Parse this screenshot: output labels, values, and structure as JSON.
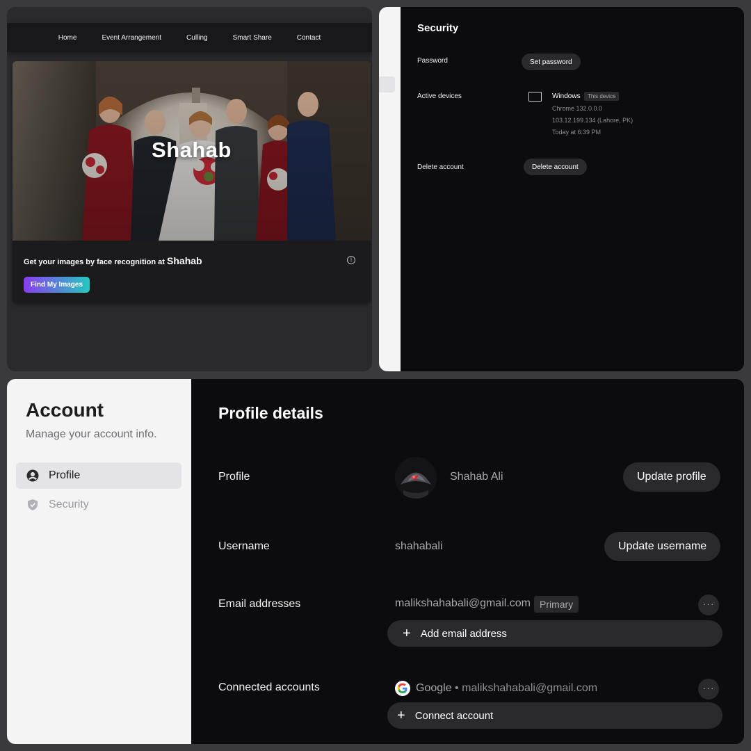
{
  "site": {
    "nav": [
      "Home",
      "Event Arrangement",
      "Culling",
      "Smart Share",
      "Contact"
    ],
    "hero_title": "Shahab",
    "tagline": "Get your images by face recognition at",
    "tagline_brand": "Shahab",
    "info_glyph": "i",
    "find_button": "Find My Images"
  },
  "security": {
    "title": "Security",
    "password_label": "Password",
    "set_password_button": "Set password",
    "active_devices_label": "Active devices",
    "device": {
      "name": "Windows",
      "badge": "This device",
      "browser": "Chrome 132.0.0.0",
      "ip": "103.12.199.134 (Lahore, PK)",
      "time": "Today at 6:39 PM"
    },
    "delete_label": "Delete account",
    "delete_button": "Delete account"
  },
  "account": {
    "title": "Account",
    "subtitle": "Manage your account info.",
    "nav": [
      {
        "label": "Profile",
        "icon": "user-circle-icon",
        "active": true
      },
      {
        "label": "Security",
        "icon": "shield-icon",
        "active": false
      }
    ]
  },
  "profile": {
    "title": "Profile details",
    "profile_label": "Profile",
    "name": "Shahab Ali",
    "update_profile_button": "Update profile",
    "username_label": "Username",
    "username": "shahabali",
    "update_username_button": "Update username",
    "email_label": "Email addresses",
    "email": "malikshahabali@gmail.com",
    "email_badge": "Primary",
    "more_glyph": "···",
    "add_email_button": "Add email address",
    "plus_glyph": "+",
    "connected_label": "Connected accounts",
    "connected_provider": "Google",
    "connected_separator": "•",
    "connected_email": "malikshahabali@gmail.com",
    "connect_button": "Connect account"
  },
  "colors": {
    "dark_bg": "#0c0c0e",
    "light_sidebar": "#f4f4f5",
    "button_bg": "#2a2a2d",
    "gradient_start": "#8a3cf0",
    "gradient_end": "#25c8c0"
  }
}
